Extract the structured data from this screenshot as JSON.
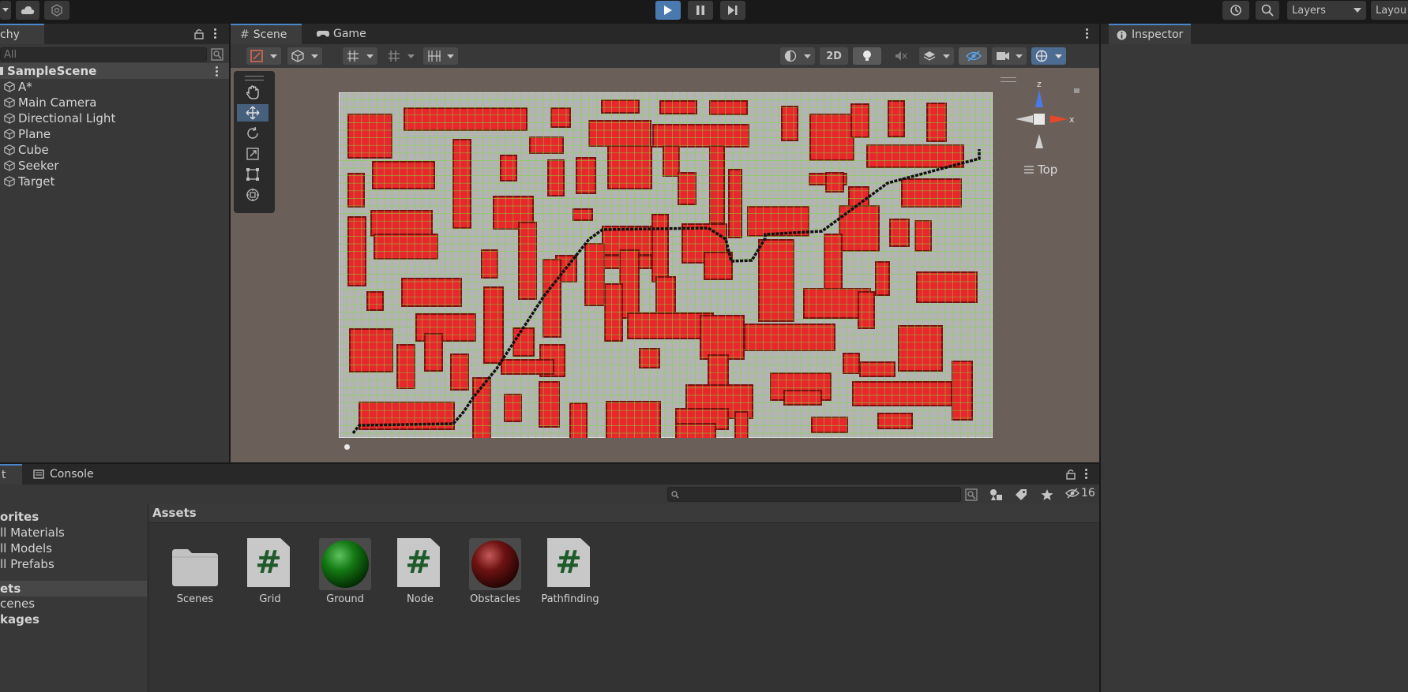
{
  "toolbar": {
    "layers_label": "Layers",
    "layout_label": "Layou"
  },
  "hierarchy": {
    "tab_label": "chy",
    "search_placeholder": "All",
    "scene_name": "SampleScene",
    "items": [
      "A*",
      "Main Camera",
      "Directional Light",
      "Plane",
      "Cube",
      "Seeker",
      "Target"
    ]
  },
  "scene_view": {
    "tabs": [
      "Scene",
      "Game"
    ],
    "mode_2d_label": "2D",
    "orientation_label": "Top",
    "axis_labels": {
      "x": "x",
      "z": "z"
    }
  },
  "inspector": {
    "tab_label": "Inspector"
  },
  "project": {
    "tabs": [
      "t",
      "Console"
    ],
    "hidden_count": "16",
    "favorites_header": "orites",
    "favorites": [
      "ll Materials",
      "ll Models",
      "ll Prefabs"
    ],
    "tree": {
      "assets": "ets",
      "scenes": "cenes",
      "packages": "kages"
    },
    "breadcrumb": "Assets",
    "assets": [
      {
        "name": "Scenes",
        "kind": "folder"
      },
      {
        "name": "Grid",
        "kind": "script"
      },
      {
        "name": "Ground",
        "kind": "material-green"
      },
      {
        "name": "Node",
        "kind": "script"
      },
      {
        "name": "Obstacles",
        "kind": "material-red"
      },
      {
        "name": "Pathfinding",
        "kind": "script"
      }
    ]
  },
  "colors": {
    "accent": "#4a86c8",
    "obstacle": "#e8262b",
    "grid_line": "#7ddc3c",
    "ground": "#b4b4b4"
  }
}
